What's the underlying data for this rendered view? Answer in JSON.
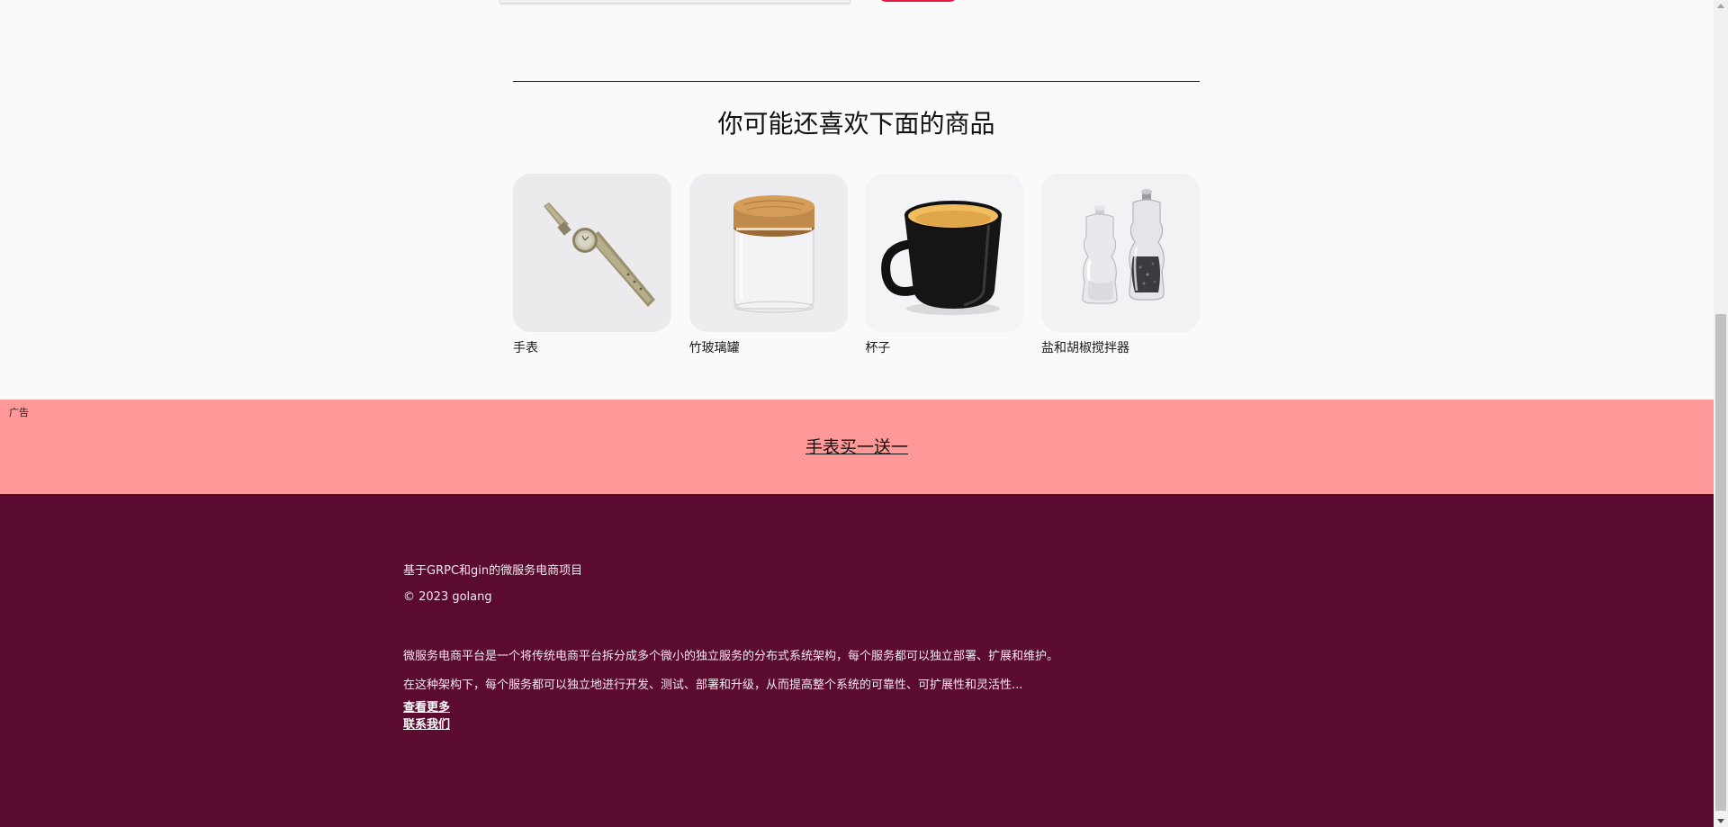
{
  "recommendations": {
    "title": "你可能还喜欢下面的商品",
    "items": [
      {
        "name": "手表",
        "image": "watch-image"
      },
      {
        "name": "竹玻璃罐",
        "image": "bamboo-glass-jar-image"
      },
      {
        "name": "杯子",
        "image": "mug-image"
      },
      {
        "name": "盐和胡椒搅拌器",
        "image": "salt-pepper-grinder-image"
      }
    ]
  },
  "ad": {
    "label": "广告",
    "link_text": "手表买一送一",
    "background": "#ff9999"
  },
  "footer": {
    "background": "#5a0b2f",
    "project": "基于GRPC和gin的微服务电商项目",
    "copyright": "© 2023 golang",
    "description_line1": "微服务电商平台是一个将传统电商平台拆分成多个微小的独立服务的分布式系统架构，每个服务都可以独立部署、扩展和维护。",
    "description_line2": "在这种架构下，每个服务都可以独立地进行开发、测试、部署和升级，从而提高整个系统的可靠性、可扩展性和灵活性...",
    "more_link": "查看更多",
    "contact_link": "联系我们"
  },
  "colors": {
    "accent_button": "#e8173d"
  }
}
